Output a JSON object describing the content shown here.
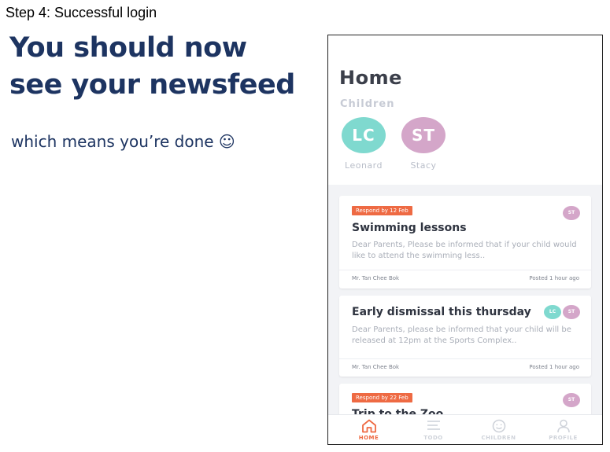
{
  "slide": {
    "step_label": "Step 4: Successful login",
    "headline_line1": "You should now",
    "headline_line2": "see your newsfeed",
    "subline": "which means you’re done ☺"
  },
  "app": {
    "title": "Home",
    "children_label": "Children",
    "children": [
      {
        "initials": "LC",
        "name": "Leonard",
        "color": "#7fd9cf"
      },
      {
        "initials": "ST",
        "name": "Stacy",
        "color": "#d4a6c9"
      }
    ],
    "feed": [
      {
        "badge": "Respond by 12 Feb",
        "title": "Swimming lessons",
        "body": "Dear Parents, Please be informed that if your child would like to attend the swimming less..",
        "author": "Mr. Tan Chee Bok",
        "posted": "Posted 1 hour ago",
        "avatars": [
          "ST"
        ]
      },
      {
        "badge": "",
        "title": "Early dismissal this thursday",
        "body": "Dear Parents, please be informed that your child will be released at 12pm at the Sports Complex..",
        "author": "Mr. Tan Chee Bok",
        "posted": "Posted 1 hour ago",
        "avatars": [
          "LC",
          "ST"
        ]
      },
      {
        "badge": "Respond by 22 Feb",
        "title": "Trip to the Zoo",
        "avatars": [
          "ST"
        ]
      }
    ],
    "tabs": [
      {
        "label": "HOME",
        "icon": "home-icon",
        "active": true
      },
      {
        "label": "TODO",
        "icon": "list-icon",
        "active": false
      },
      {
        "label": "CHILDREN",
        "icon": "smiley-icon",
        "active": false
      },
      {
        "label": "PROFILE",
        "icon": "person-icon",
        "active": false
      }
    ],
    "colors": {
      "accent": "#ee6a43",
      "headline": "#1d3461",
      "lc": "#7fd9cf",
      "st": "#d4a6c9"
    }
  }
}
